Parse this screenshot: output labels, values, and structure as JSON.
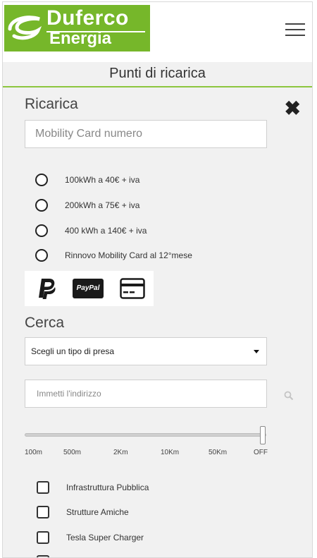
{
  "header": {
    "brand_line1": "Duferco",
    "brand_line2": "Energia",
    "menu_icon": "hamburger-icon"
  },
  "page_title": "Punti di ricarica",
  "ricarica": {
    "title": "Ricarica",
    "close_icon": "close-icon",
    "card_placeholder": "Mobility Card numero",
    "options": [
      "100kWh a 40€ + iva",
      "200kWh a 75€ + iva",
      "400 kWh a 140€ + iva",
      "Rinnovo Mobility Card al 12°mese"
    ],
    "payment_icons": [
      "paypal-p-icon",
      "paypal-icon",
      "credit-card-icon"
    ],
    "paypal_text": "PayPal"
  },
  "cerca": {
    "title": "Cerca",
    "plug_select_value": "Scegli un tipo di presa",
    "address_placeholder": "Immetti l'indirizzo",
    "distance_ticks": [
      "100m",
      "500m",
      "2Km",
      "10Km",
      "50Km",
      "OFF"
    ],
    "distance_value": "OFF",
    "filters": [
      "Infrastruttura Pubblica",
      "Strutture Amiche",
      "Tesla Super Charger",
      ""
    ]
  },
  "colors": {
    "brand_green": "#76b72a",
    "accent_line": "#8dc63f",
    "panel_bg": "#f1f1f1"
  }
}
